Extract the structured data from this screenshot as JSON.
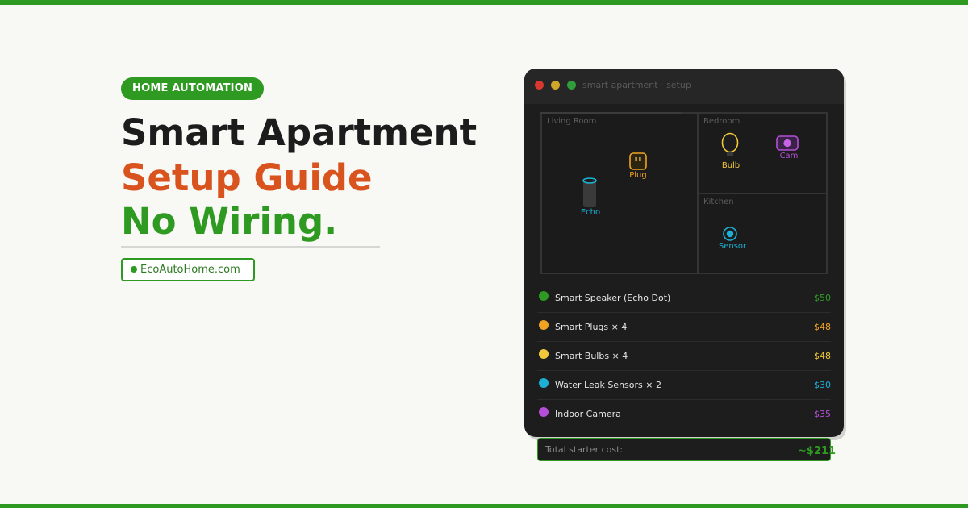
{
  "badge": "HOME AUTOMATION",
  "headline": {
    "line1": "Smart Apartment",
    "line2": "Setup Guide",
    "line3": "No Wiring."
  },
  "site": "EcoAutoHome.com",
  "window": {
    "title": "smart apartment · setup",
    "rooms": {
      "living": "Living Room",
      "bedroom": "Bedroom",
      "kitchen": "Kitchen"
    },
    "devices": {
      "plug": "Plug",
      "echo": "Echo",
      "bulb": "Bulb",
      "cam": "Cam",
      "sensor": "Sensor"
    },
    "items": [
      {
        "name": "Smart Speaker (Echo Dot)",
        "price": "$50",
        "color": "#2e9a22"
      },
      {
        "name": "Smart Plugs × 4",
        "price": "$48",
        "color": "#f0a323"
      },
      {
        "name": "Smart Bulbs × 4",
        "price": "$48",
        "color": "#f1c83a"
      },
      {
        "name": "Water Leak Sensors × 2",
        "price": "$30",
        "color": "#1cb0d4"
      },
      {
        "name": "Indoor Camera",
        "price": "$35",
        "color": "#b54fd8"
      }
    ]
  },
  "total": {
    "label": "Total starter cost:",
    "value": "~$211"
  },
  "colors": {
    "accent_green": "#2e9a22",
    "accent_orange": "#d9531e",
    "plug": "#f0a323",
    "bulb": "#f1c83a",
    "sensor": "#1cb0d4",
    "camera": "#b54fd8"
  }
}
